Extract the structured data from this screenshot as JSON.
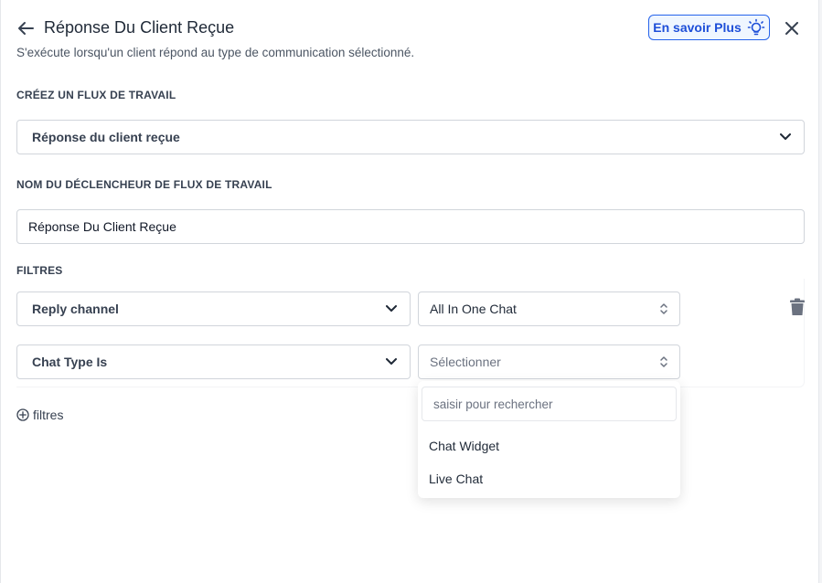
{
  "header": {
    "title": "Réponse Du Client Reçue",
    "learn_more_label": "En savoir Plus",
    "subtitle": "S'exécute lorsqu'un client répond au type de communication sélectionné."
  },
  "workflow": {
    "section_label": "CRÉEZ UN FLUX DE TRAVAIL",
    "selected": "Réponse du client reçue"
  },
  "trigger_name": {
    "section_label": "NOM DU DÉCLENCHEUR DE FLUX DE TRAVAIL",
    "value": "Réponse Du Client Reçue"
  },
  "filters": {
    "section_label": "FILTRES",
    "rows": [
      {
        "field": "Reply channel",
        "value": "All In One Chat"
      },
      {
        "field": "Chat Type Is",
        "value": "",
        "placeholder": "Sélectionner"
      }
    ],
    "add_label": "filtres"
  },
  "dropdown": {
    "search_placeholder": "saisir pour rechercher",
    "options": [
      "Chat Widget",
      "Live Chat"
    ]
  },
  "colors": {
    "accent": "#2563eb",
    "accent_bg": "#eff6ff",
    "border": "#d1d5db"
  }
}
